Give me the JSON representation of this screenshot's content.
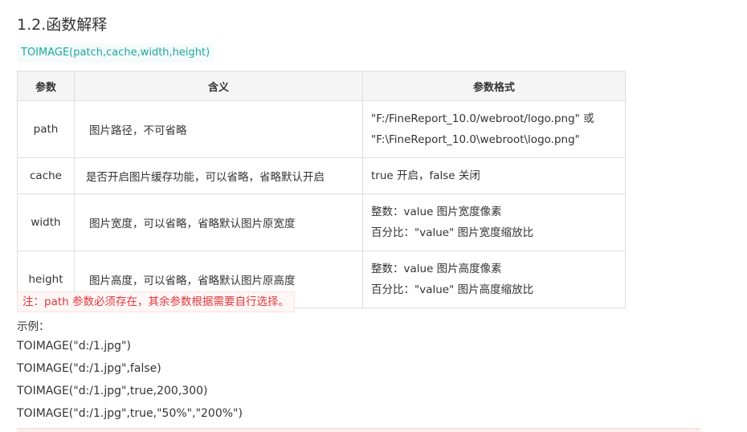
{
  "section": {
    "heading": "1.2.函数解释"
  },
  "signature": "TOIMAGE(patch,cache,width,height)",
  "table": {
    "headers": [
      "参数",
      "含义",
      "参数格式"
    ],
    "rows": [
      {
        "name": "path",
        "desc": "图片路径，不可省略",
        "fmt": [
          "\"F:/FineReport_10.0/webroot/logo.png\" 或",
          "\"F:\\FineReport_10.0\\webroot\\logo.png\""
        ]
      },
      {
        "name": "cache",
        "desc": "是否开启图片缓存功能，可以省略，省略默认开启",
        "fmt": [
          "true 开启，false 关闭"
        ]
      },
      {
        "name": "width",
        "desc": "图片宽度，可以省略，省略默认图片原宽度",
        "fmt": [
          "整数：value 图片宽度像素",
          "百分比：\"value\" 图片宽度缩放比"
        ]
      },
      {
        "name": "height",
        "desc": "图片高度，可以省略，省略默认图片原高度",
        "fmt": [
          "整数：value 图片高度像素",
          "百分比：\"value\" 图片高度缩放比"
        ]
      }
    ]
  },
  "note": "注：path 参数必须存在，其余参数根据需要自行选择。",
  "example": {
    "label": "示例：",
    "lines": [
      "TOIMAGE(\"d:/1.jpg\")",
      "TOIMAGE(\"d:/1.jpg\",false)",
      "TOIMAGE(\"d:/1.jpg\",true,200,300)",
      "TOIMAGE(\"d:/1.jpg\",true,\"50%\",\"200%\")"
    ]
  }
}
